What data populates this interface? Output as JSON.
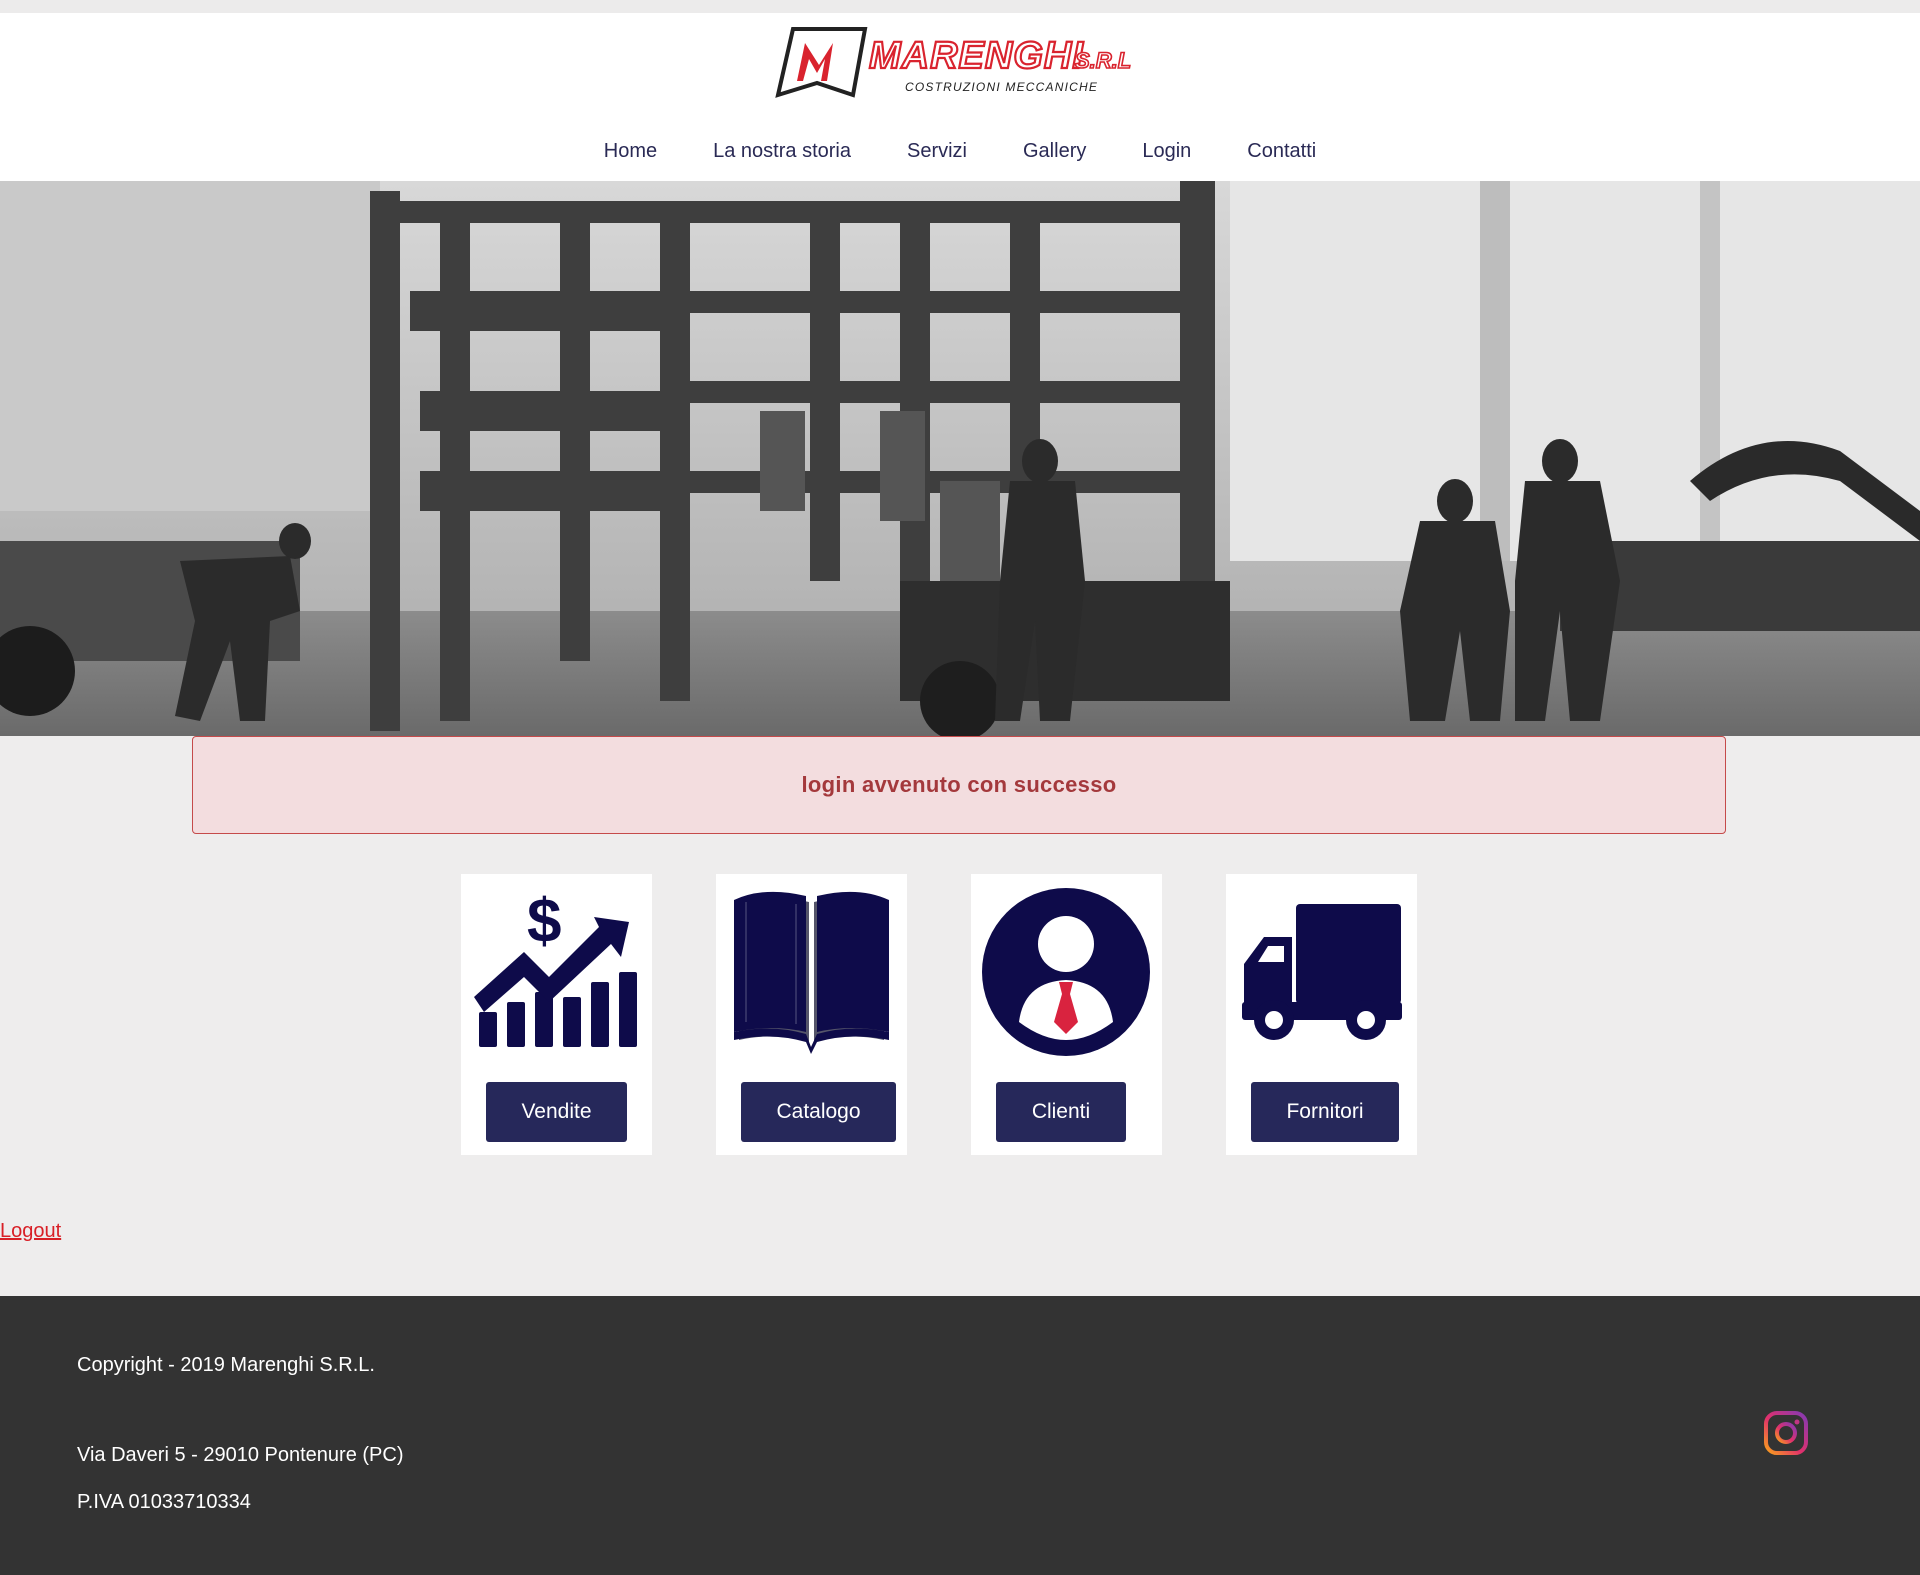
{
  "brand": {
    "name": "MARENGHI",
    "suffix": "S.R.L",
    "tagline": "COSTRUZIONI MECCANICHE"
  },
  "nav": {
    "items": [
      {
        "label": "Home"
      },
      {
        "label": "La nostra storia"
      },
      {
        "label": "Servizi"
      },
      {
        "label": "Gallery"
      },
      {
        "label": "Login"
      },
      {
        "label": "Contatti"
      }
    ]
  },
  "alert": {
    "message": "login avvenuto con successo"
  },
  "cards": [
    {
      "label": "Vendite",
      "icon": "sales-chart-icon"
    },
    {
      "label": "Catalogo",
      "icon": "open-book-icon"
    },
    {
      "label": "Clienti",
      "icon": "client-person-icon"
    },
    {
      "label": "Fornitori",
      "icon": "delivery-truck-icon"
    }
  ],
  "logout": {
    "label": "Logout"
  },
  "footer": {
    "copyright": "Copyright - 2019 Marenghi S.R.L.",
    "address": "Via Daveri 5 - 29010 Pontenure (PC)",
    "vat": "P.IVA 01033710334",
    "social_icon": "instagram-icon"
  },
  "colors": {
    "navy": "#26285a",
    "icon_navy": "#0e0b4a",
    "alert_bg": "#f3dddf",
    "alert_text": "#a4393c",
    "footer_bg": "#333333",
    "link_red": "#d81f26",
    "brand_red": "#d9232e"
  }
}
